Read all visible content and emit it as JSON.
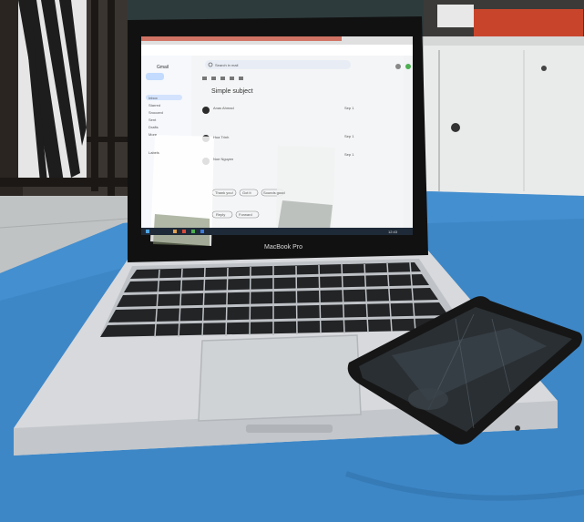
{
  "laptop": {
    "brand_label": "MacBook Pro"
  },
  "screen": {
    "app_name": "Gmail",
    "search_placeholder": "Search in mail",
    "thread_subject": "Simple subject",
    "sidebar_items": [
      "Inbox",
      "Starred",
      "Snoozed",
      "Sent",
      "Drafts",
      "More"
    ],
    "sidebar_section": "Labels",
    "messages": [
      {
        "sender": "Anas Ahmad",
        "date": "Sep 1"
      },
      {
        "sender": "Hua Trinh",
        "date": "Sep 1"
      },
      {
        "sender": "Noe Nguyen",
        "date": "Sep 1"
      }
    ],
    "smart_replies": [
      "Thank you!",
      "Got it",
      "Sounds good"
    ],
    "actions": [
      "Reply",
      "Forward"
    ],
    "taskbar_time": "12:43"
  },
  "colors": {
    "cloth": "#3d87c7",
    "laptop_body": "#d7d9dc",
    "bezel": "#111111",
    "gmail_accent": "#e8453c"
  }
}
